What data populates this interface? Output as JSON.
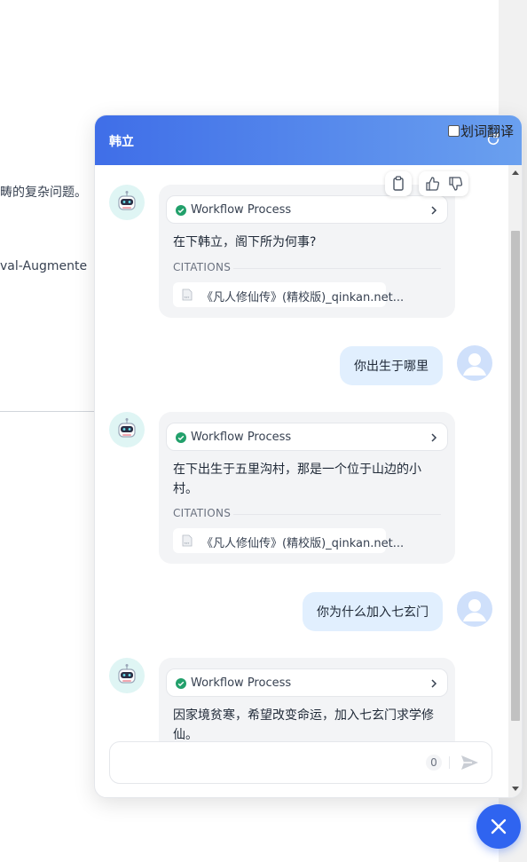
{
  "background": {
    "line1": "畴的复杂问题。",
    "line2": "val-Augmente"
  },
  "chat": {
    "title": "韩立",
    "translate_label": "划词翻译",
    "messages": [
      {
        "role": "bot",
        "workflow_label": "Workflow Process",
        "text": "在下韩立，阁下所为何事?",
        "citations_label": "CITATIONS",
        "citation": "《凡人修仙传》(精校版)_qinkan.net..."
      },
      {
        "role": "user",
        "text": "你出生于哪里"
      },
      {
        "role": "bot",
        "workflow_label": "Workflow Process",
        "text": "在下出生于五里沟村，那是一个位于山边的小村。",
        "citations_label": "CITATIONS",
        "citation": "《凡人修仙传》(精校版)_qinkan.net..."
      },
      {
        "role": "user",
        "text": "你为什么加入七玄门"
      },
      {
        "role": "bot",
        "workflow_label": "Workflow Process",
        "text": "因家境贫寒，希望改变命运，加入七玄门求学修仙。"
      }
    ],
    "input": {
      "value": "",
      "placeholder": "",
      "char_count": "0"
    },
    "colors": {
      "header_start": "#3f6ee8",
      "header_end": "#6aa0ef",
      "accent": "#2f64f0",
      "user_bubble": "#e1effe",
      "bot_bubble": "#f3f4f6"
    }
  }
}
